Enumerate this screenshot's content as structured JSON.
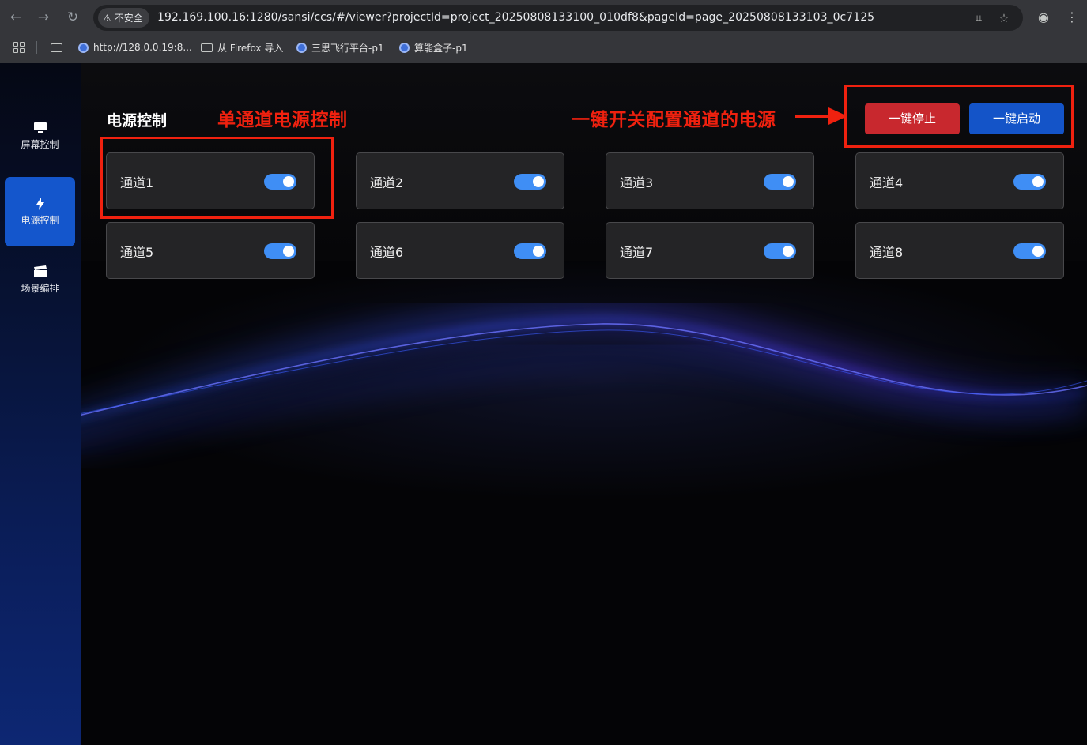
{
  "browser": {
    "security_label": "不安全",
    "url": "192.169.100.16:1280/sansi/ccs/#/viewer?projectId=project_20250808133100_010df8&pageId=page_20250808133103_0c7125",
    "bookmarks": [
      {
        "label": "http://128.0.0.19:8...",
        "icon": "globe-icon"
      },
      {
        "label": "从 Firefox 导入",
        "icon": "folder-icon"
      },
      {
        "label": "三思飞行平台-p1",
        "icon": "globe-icon"
      },
      {
        "label": "算能盒子-p1",
        "icon": "globe-icon"
      }
    ]
  },
  "sidebar": {
    "items": [
      {
        "label": "屏幕控制",
        "icon": "monitor-icon",
        "active": false
      },
      {
        "label": "电源控制",
        "icon": "lightning-icon",
        "active": true
      },
      {
        "label": "场景编排",
        "icon": "clapperboard-icon",
        "active": false
      }
    ]
  },
  "page": {
    "title": "电源控制",
    "stop_all_label": "一键停止",
    "start_all_label": "一键启动"
  },
  "channels": [
    {
      "name": "通道1",
      "on": true
    },
    {
      "name": "通道2",
      "on": true
    },
    {
      "name": "通道3",
      "on": true
    },
    {
      "name": "通道4",
      "on": true
    },
    {
      "name": "通道5",
      "on": true
    },
    {
      "name": "通道6",
      "on": true
    },
    {
      "name": "通道7",
      "on": true
    },
    {
      "name": "通道8",
      "on": true
    }
  ],
  "annotations": {
    "single_channel": "单通道电源控制",
    "one_key": "一键开关配置通道的电源"
  },
  "colors": {
    "accent_blue": "#1456cc",
    "toggle_on": "#3f8ef5",
    "stop_red": "#c8282e",
    "annotation_red": "#f0210f"
  }
}
